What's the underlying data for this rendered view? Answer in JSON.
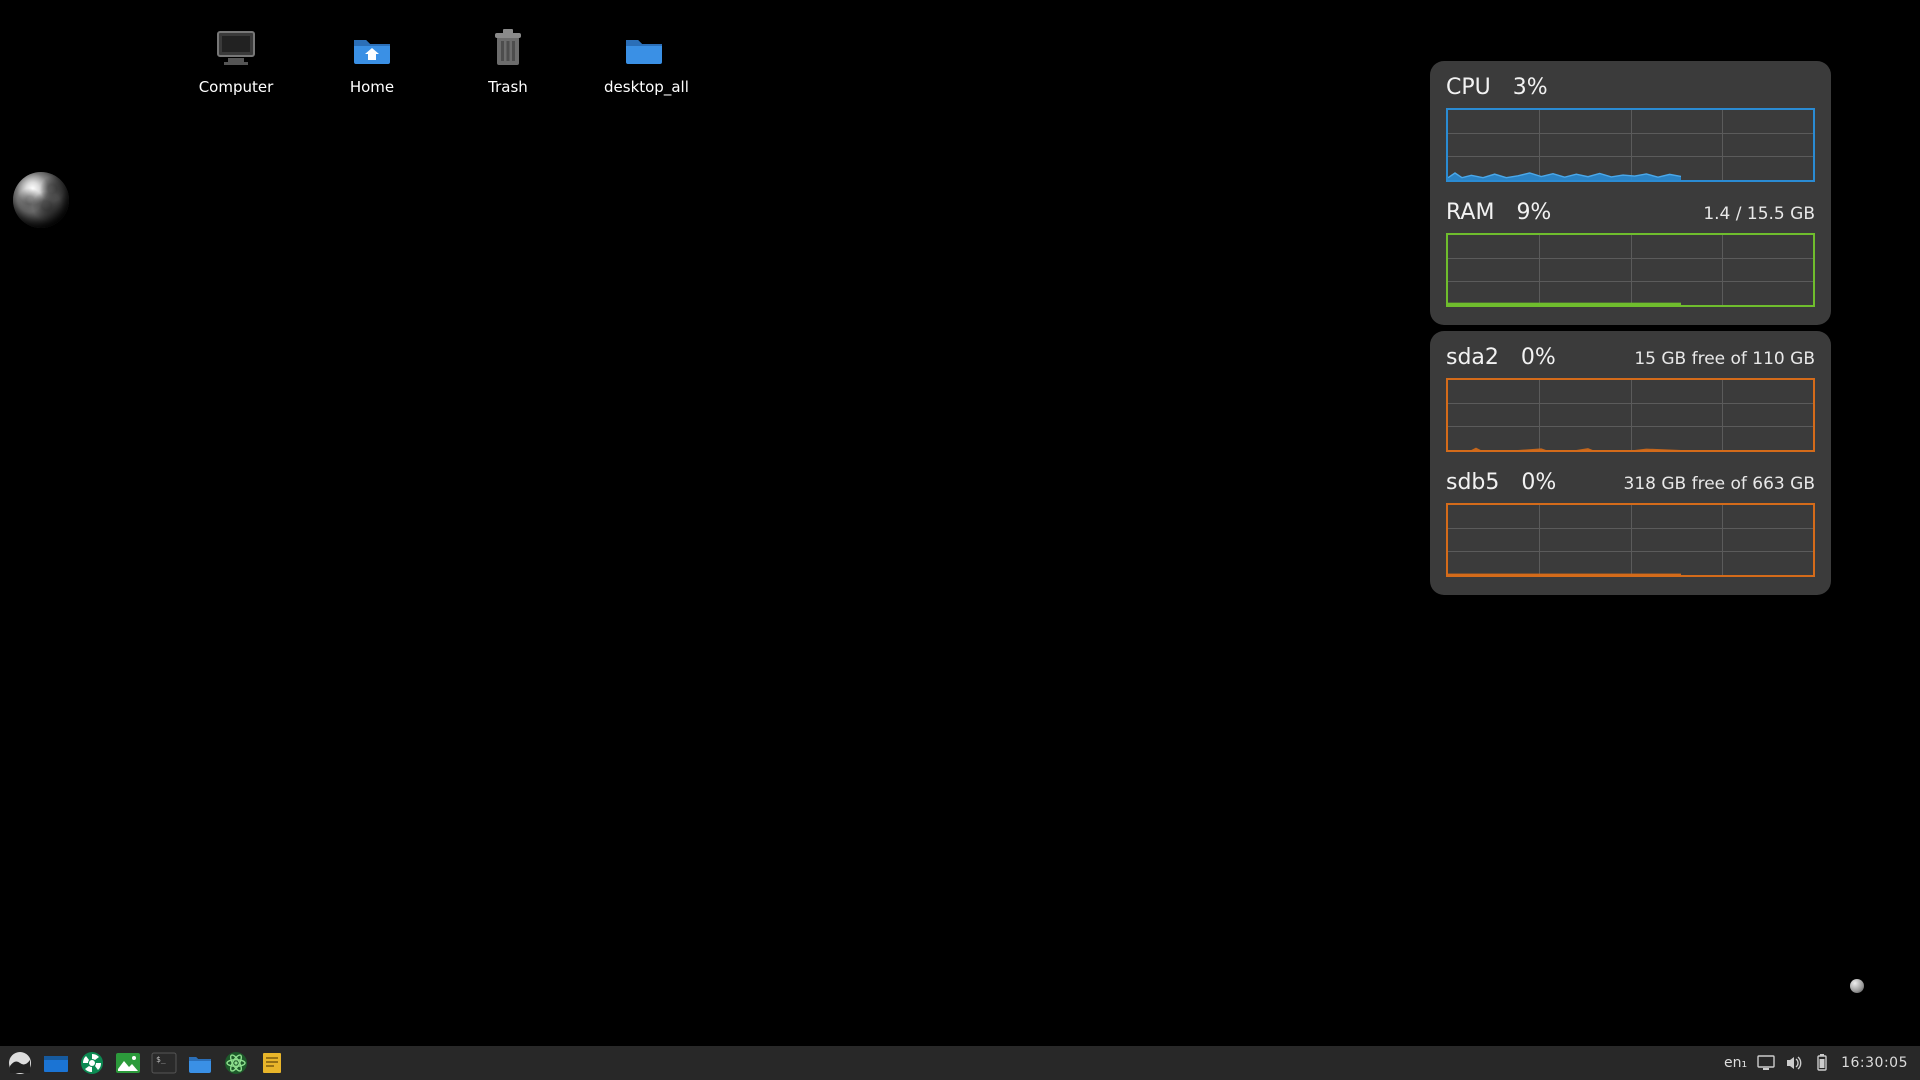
{
  "desktop_icons": [
    {
      "id": "computer",
      "label": "Computer"
    },
    {
      "id": "home",
      "label": "Home"
    },
    {
      "id": "trash",
      "label": "Trash"
    },
    {
      "id": "desktop-all",
      "label": "desktop_all"
    }
  ],
  "monitors": {
    "cpu": {
      "name": "CPU",
      "percent": "3%",
      "detail": ""
    },
    "ram": {
      "name": "RAM",
      "percent": "9%",
      "detail": "1.4 / 15.5 GB"
    },
    "sda2": {
      "name": "sda2",
      "percent": "0%",
      "detail": "15 GB free of 110 GB"
    },
    "sdb5": {
      "name": "sdb5",
      "percent": "0%",
      "detail": "318 GB free of 663 GB"
    }
  },
  "taskbar": {
    "lang": "en₁",
    "clock": "16:30:05"
  },
  "colors": {
    "cpu": "#2a8bd3",
    "ram": "#6fbd2d",
    "disk": "#d46b1a",
    "folder": "#3a90e5"
  }
}
